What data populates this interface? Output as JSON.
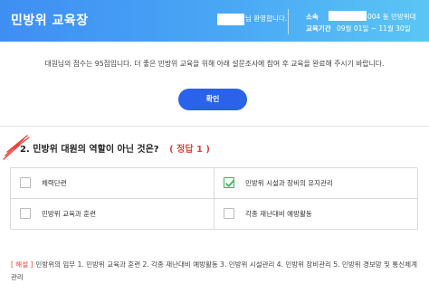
{
  "header": {
    "app_title": "민방위 교육장",
    "greeting": "님 환영합니다.",
    "affiliation_label": "소속",
    "affiliation_value": "004 동 민방위대",
    "period_label": "교육기간",
    "period_value": "09월 01일 ~ 11월 30일"
  },
  "notice": {
    "message": "대원님의 점수는 95점입니다. 더 좋은 민방위 교육을 위해 아래 설문조사에 참여 후 교육을 완료해 주시기 바랍니다.",
    "confirm_label": "확인"
  },
  "quiz": {
    "question_number": "2.",
    "question_text": "민방위 대원의 역할이 아닌 것은?",
    "answer_text": "( 정답 1 )",
    "options": [
      {
        "label": "체력단련",
        "checked": false
      },
      {
        "label": "민방위 시설과 장비의 유지관리",
        "checked": true
      },
      {
        "label": "민방위 교육과 훈련",
        "checked": false
      },
      {
        "label": "각종 재난대비 예방활동",
        "checked": false
      }
    ],
    "explanation_tag": "[ 해설 ]",
    "explanation_text": "민방위의 임무 1. 민방위 교육과 훈련 2. 각종 재난대비 예방활동 3. 민방위 시설관리 4. 민방위 장비관리 5. 민방위 경보망 및 통신체계 관리"
  },
  "colors": {
    "header_gradient_start": "#3f8ef3",
    "header_gradient_end": "#5bc6f4",
    "button": "#2a62ea",
    "answer": "#e8423b",
    "check": "#3bb44a"
  }
}
